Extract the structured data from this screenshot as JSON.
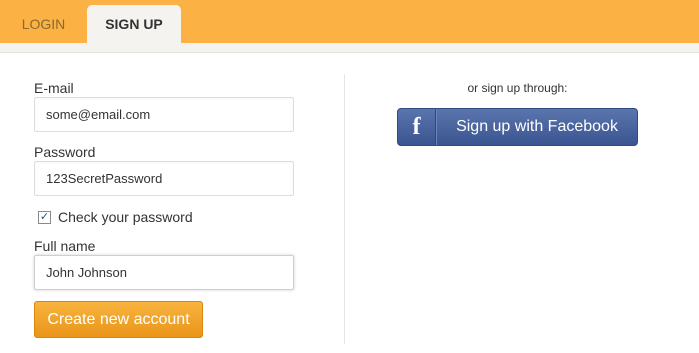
{
  "tabs": [
    {
      "label": "LOGIN",
      "active": false
    },
    {
      "label": "SIGN UP",
      "active": true
    }
  ],
  "form": {
    "email": {
      "label": "E-mail",
      "value": "some@email.com"
    },
    "password": {
      "label": "Password",
      "value": "123SecretPassword"
    },
    "check_password": {
      "label": "Check your password",
      "checked": true,
      "mark": "✓"
    },
    "full_name": {
      "label": "Full name",
      "value": "John Johnson"
    },
    "submit_label": "Create new account"
  },
  "social": {
    "prompt": "or sign up through:",
    "facebook_icon": "f",
    "facebook_label": "Sign up with Facebook"
  },
  "colors": {
    "topbar": "#fbb143",
    "primary_button": "#f0a22c",
    "facebook": "#3b5998"
  }
}
